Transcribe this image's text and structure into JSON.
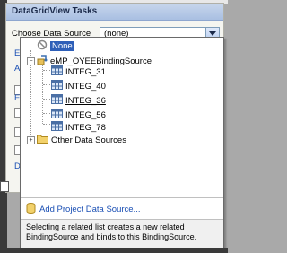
{
  "panel": {
    "title": "DataGridView Tasks",
    "choose_label": "Choose Data Source",
    "combo_value": "(none)"
  },
  "side_links": [
    "Ed",
    "Ad",
    "Ed",
    "De"
  ],
  "dropdown": {
    "items": {
      "none": "None",
      "binding_source": "eMP_OYEEBindingSource",
      "integ31": "INTEG_31",
      "integ40": "INTEG_40",
      "integ36": "INTEG_36",
      "integ56": "INTEG_56",
      "integ78": "INTEG_78",
      "other": "Other Data Sources"
    },
    "add_link": "Add Project Data Source...",
    "description": "Selecting a related list creates a new related BindingSource and binds to this BindingSource."
  },
  "icons": {
    "none": "no-entry-icon",
    "binding_source": "binding-source-icon",
    "table": "table-icon",
    "folder": "folder-icon",
    "database": "database-icon"
  },
  "colors": {
    "selection": "#2e5fb8",
    "link": "#1a4fb4",
    "header": "#a9bfe2"
  }
}
